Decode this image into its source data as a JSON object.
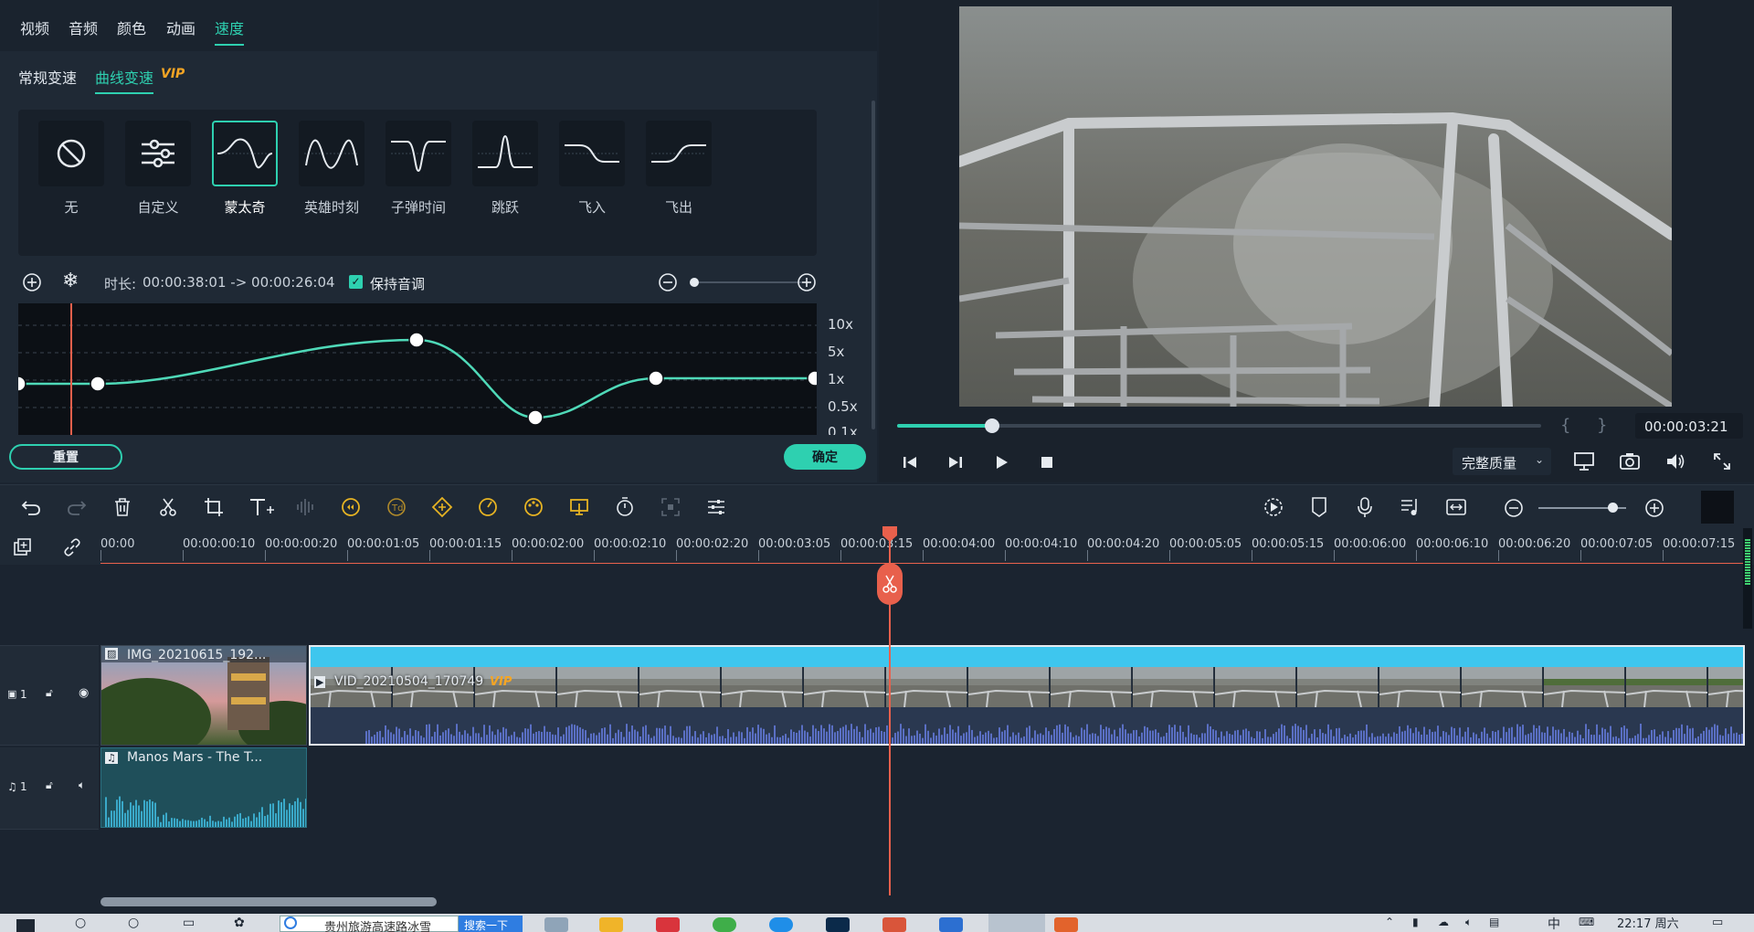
{
  "effect_panel": {
    "tabs": [
      {
        "label": "视频"
      },
      {
        "label": "音频"
      },
      {
        "label": "颜色"
      },
      {
        "label": "动画"
      },
      {
        "label": "速度",
        "active": true
      }
    ],
    "subtabs": [
      {
        "label": "常规变速"
      },
      {
        "label": "曲线变速",
        "active": true,
        "badge": "VIP"
      }
    ],
    "presets": [
      {
        "label": "无",
        "icon": "none-icon"
      },
      {
        "label": "自定义",
        "icon": "sliders-icon"
      },
      {
        "label": "蒙太奇",
        "icon": "montage-curve-icon",
        "selected": true
      },
      {
        "label": "英雄时刻",
        "icon": "hero-moment-curve-icon"
      },
      {
        "label": "子弹时间",
        "icon": "bullet-time-curve-icon"
      },
      {
        "label": "跳跃",
        "icon": "jump-curve-icon"
      },
      {
        "label": "飞入",
        "icon": "fly-in-curve-icon"
      },
      {
        "label": "飞出",
        "icon": "fly-out-curve-icon"
      }
    ],
    "duration_label": "时长:",
    "duration_value": "00:00:38:01 -> 00:00:26:04",
    "keep_pitch_label": "保持音调",
    "keep_pitch_checked": true,
    "curve": {
      "y_labels": [
        "10x",
        "5x",
        "1x",
        "0.5x",
        "0.1x"
      ],
      "points": [
        {
          "t": 0.0,
          "speed": "1x"
        },
        {
          "t": 0.08,
          "speed": "1x"
        },
        {
          "t": 0.49,
          "speed": "~4x"
        },
        {
          "t": 0.64,
          "speed": "~0.4x"
        },
        {
          "t": 0.78,
          "speed": "1x"
        },
        {
          "t": 1.0,
          "speed": "1x"
        }
      ]
    },
    "reset_label": "重置",
    "ok_label": "确定"
  },
  "preview": {
    "timecode": "00:00:03:21",
    "progress": 0.15,
    "quality_label": "完整质量",
    "mark_in": "{",
    "mark_out": "}"
  },
  "toolbar": {
    "left_icons": [
      "undo-icon",
      "redo-icon",
      "delete-icon",
      "cut-icon",
      "crop-icon",
      "text-icon",
      "audio-split-icon",
      "speed-icon",
      "text-to-speech-icon",
      "keyframe-icon",
      "speed-ramp-icon",
      "color-icon",
      "stabilize-icon",
      "duration-icon",
      "fit-icon",
      "settings-icon"
    ],
    "right_icons": [
      "render-icon",
      "marker-icon",
      "mic-icon",
      "music-icon",
      "snap-icon"
    ]
  },
  "ruler": {
    "ticks": [
      "00:00",
      "00:00:00:10",
      "00:00:00:20",
      "00:00:01:05",
      "00:00:01:15",
      "00:00:02:00",
      "00:00:02:10",
      "00:00:02:20",
      "00:00:03:05",
      "00:00:03:15",
      "00:00:04:00",
      "00:00:04:10",
      "00:00:04:20",
      "00:00:05:05",
      "00:00:05:15",
      "00:00:06:00",
      "00:00:06:10",
      "00:00:06:20",
      "00:00:07:05",
      "00:00:07:15"
    ]
  },
  "tracks": {
    "video_track_label": "1",
    "audio_track_label": "1",
    "clips": {
      "image_clip": "IMG_20210615_192...",
      "video_clip": "VID_20210504_170749",
      "video_clip_badge": "VIP",
      "audio_clip": "Manos Mars - The T..."
    }
  },
  "taskbar": {
    "search_text": "贵州旅游高速路冰雪",
    "search_button": "搜索一下",
    "time": "22:17 周六",
    "ime": "中"
  },
  "colors": {
    "accent": "#2ed0b0",
    "playhead": "#e8604c",
    "vip": "#f5a524",
    "video_clip_top": "#3ec6ee",
    "audio_wave": "#5a6fc4"
  }
}
